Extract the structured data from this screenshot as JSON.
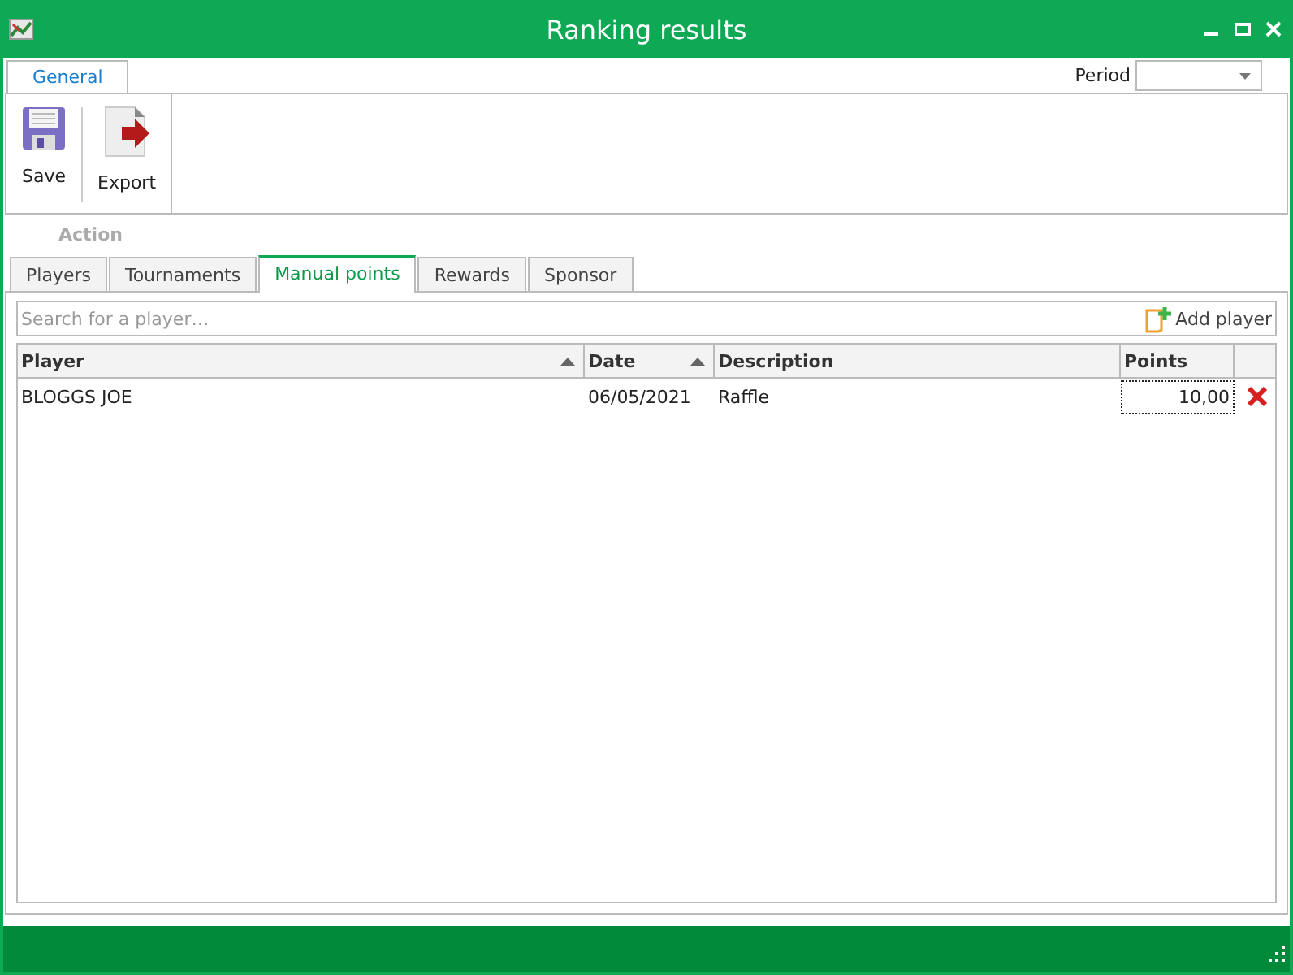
{
  "window": {
    "title": "Ranking results"
  },
  "ribbon": {
    "tabs": [
      {
        "label": "General",
        "selected": true
      }
    ],
    "period_label": "Period",
    "buttons": [
      {
        "label": "Save",
        "kind": "save"
      },
      {
        "label": "Export",
        "kind": "export"
      }
    ],
    "group_label": "Action"
  },
  "tabs": [
    {
      "label": "Players",
      "selected": false
    },
    {
      "label": "Tournaments",
      "selected": false
    },
    {
      "label": "Manual points",
      "selected": true
    },
    {
      "label": "Rewards",
      "selected": false
    },
    {
      "label": "Sponsor",
      "selected": false
    }
  ],
  "search": {
    "placeholder": "Search for a player…"
  },
  "add_button": "Add player",
  "table": {
    "columns": [
      {
        "label": "Player",
        "sorted": true
      },
      {
        "label": "Date",
        "sorted": true
      },
      {
        "label": "Description",
        "sorted": false
      },
      {
        "label": "Points",
        "sorted": false
      }
    ],
    "rows": [
      {
        "cells": [
          "BLOGGS JOE",
          "06/05/2021",
          "Raffle",
          "10,00"
        ]
      }
    ]
  }
}
